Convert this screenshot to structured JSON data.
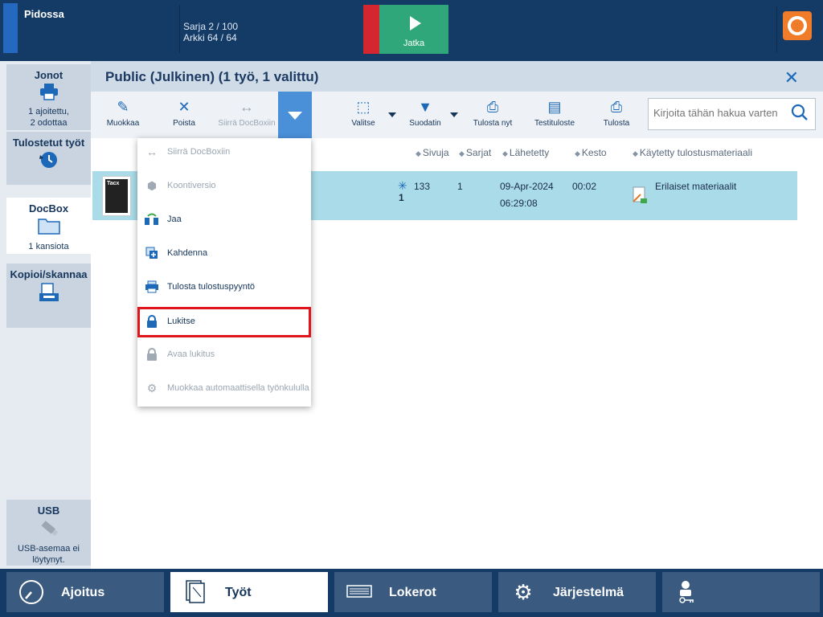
{
  "topbar": {
    "state": "Pidossa",
    "set_progress": "Sarja 2 / 100",
    "sheet_progress": "Arkki 64 / 64",
    "continue_label": "Jatka"
  },
  "nav": {
    "jonot": {
      "title": "Jonot",
      "sub1": "1 ajoitettu,",
      "sub2": "2 odottaa"
    },
    "tulostetut": {
      "title": "Tulostetut työt"
    },
    "docbox": {
      "title": "DocBox",
      "sub": "1 kansiota"
    },
    "kopioi": {
      "title": "Kopioi/skannaa"
    },
    "usb": {
      "title": "USB",
      "sub1": "USB-asemaa ei",
      "sub2": "löytynyt."
    }
  },
  "header": {
    "title": "Public (Julkinen) (1 työ, 1 valittu)"
  },
  "toolbar": {
    "edit": "Muokkaa",
    "delete": "Poista",
    "move": "Siirrä DocBoxiin",
    "select": "Valitse",
    "filter": "Suodatin",
    "print_now": "Tulosta nyt",
    "proof": "Testituloste",
    "print": "Tulosta"
  },
  "search": {
    "placeholder": "Kirjoita tähän hakua varten"
  },
  "columns": {
    "pages": "Sivuja",
    "sets": "Sarjat",
    "submitted": "Lähetetty",
    "duration": "Kesto",
    "media": "Käytetty tulostusmateriaali"
  },
  "job": {
    "thumb_text": "Tacx",
    "pages": "133",
    "pages_sub": "1",
    "sets": "1",
    "date": "09-Apr-2024",
    "time": "06:29:08",
    "duration": "00:02",
    "media": "Erilaiset materiaalit"
  },
  "menu": {
    "items": [
      {
        "label": "Siirrä DocBoxiin",
        "icon": "move-icon",
        "enabled": false
      },
      {
        "label": "Koontiversio",
        "icon": "cube-icon",
        "enabled": false
      },
      {
        "label": "Jaa",
        "icon": "share-icon",
        "enabled": true
      },
      {
        "label": "Kahdenna",
        "icon": "duplicate-icon",
        "enabled": true
      },
      {
        "label": "Tulosta tulostuspyyntö",
        "icon": "print-request-icon",
        "enabled": true
      },
      {
        "label": "Lukitse",
        "icon": "lock-icon",
        "enabled": true,
        "highlighted": true
      },
      {
        "label": "Avaa lukitus",
        "icon": "unlock-icon",
        "enabled": false
      },
      {
        "label": "Muokkaa automaattisella työnkululla",
        "icon": "gear-icon",
        "enabled": false
      }
    ]
  },
  "bottombar": {
    "ajoitus": "Ajoitus",
    "tyot": "Työt",
    "lokerot": "Lokerot",
    "jarjestelma": "Järjestelmä"
  },
  "colors": {
    "accent": "#1d69b8",
    "selected_row": "#a9dce8",
    "highlight": "#e0151c",
    "continue": "#2fa77a",
    "stop": "#d4262e"
  }
}
